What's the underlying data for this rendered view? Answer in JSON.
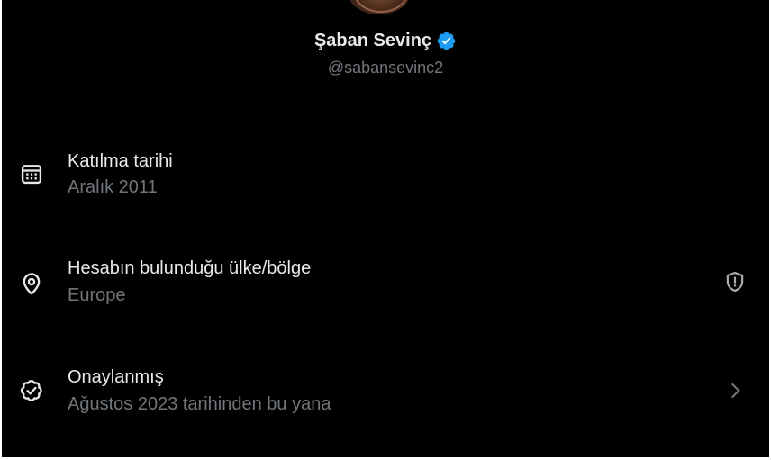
{
  "profile": {
    "name": "Şaban Sevinç",
    "handle": "@sabansevinc2",
    "verified_icon": "verified-badge-icon"
  },
  "details": [
    {
      "title": "Katılma tarihi",
      "value": "Aralık 2011",
      "icon": "calendar-icon"
    },
    {
      "title": "Hesabın bulunduğu ülke/bölge",
      "value": "Europe",
      "icon": "location-pin-icon",
      "trailing_icon": "shield-alert-icon"
    },
    {
      "title": "Onaylanmış",
      "value": "Ağustos 2023 tarihinden bu yana",
      "icon": "verified-check-icon",
      "trailing_icon": "chevron-right-icon"
    }
  ],
  "colors": {
    "background": "#000000",
    "primary_text": "#e7e9ea",
    "secondary_text": "#71767b",
    "verified_blue": "#1d9bf0"
  }
}
